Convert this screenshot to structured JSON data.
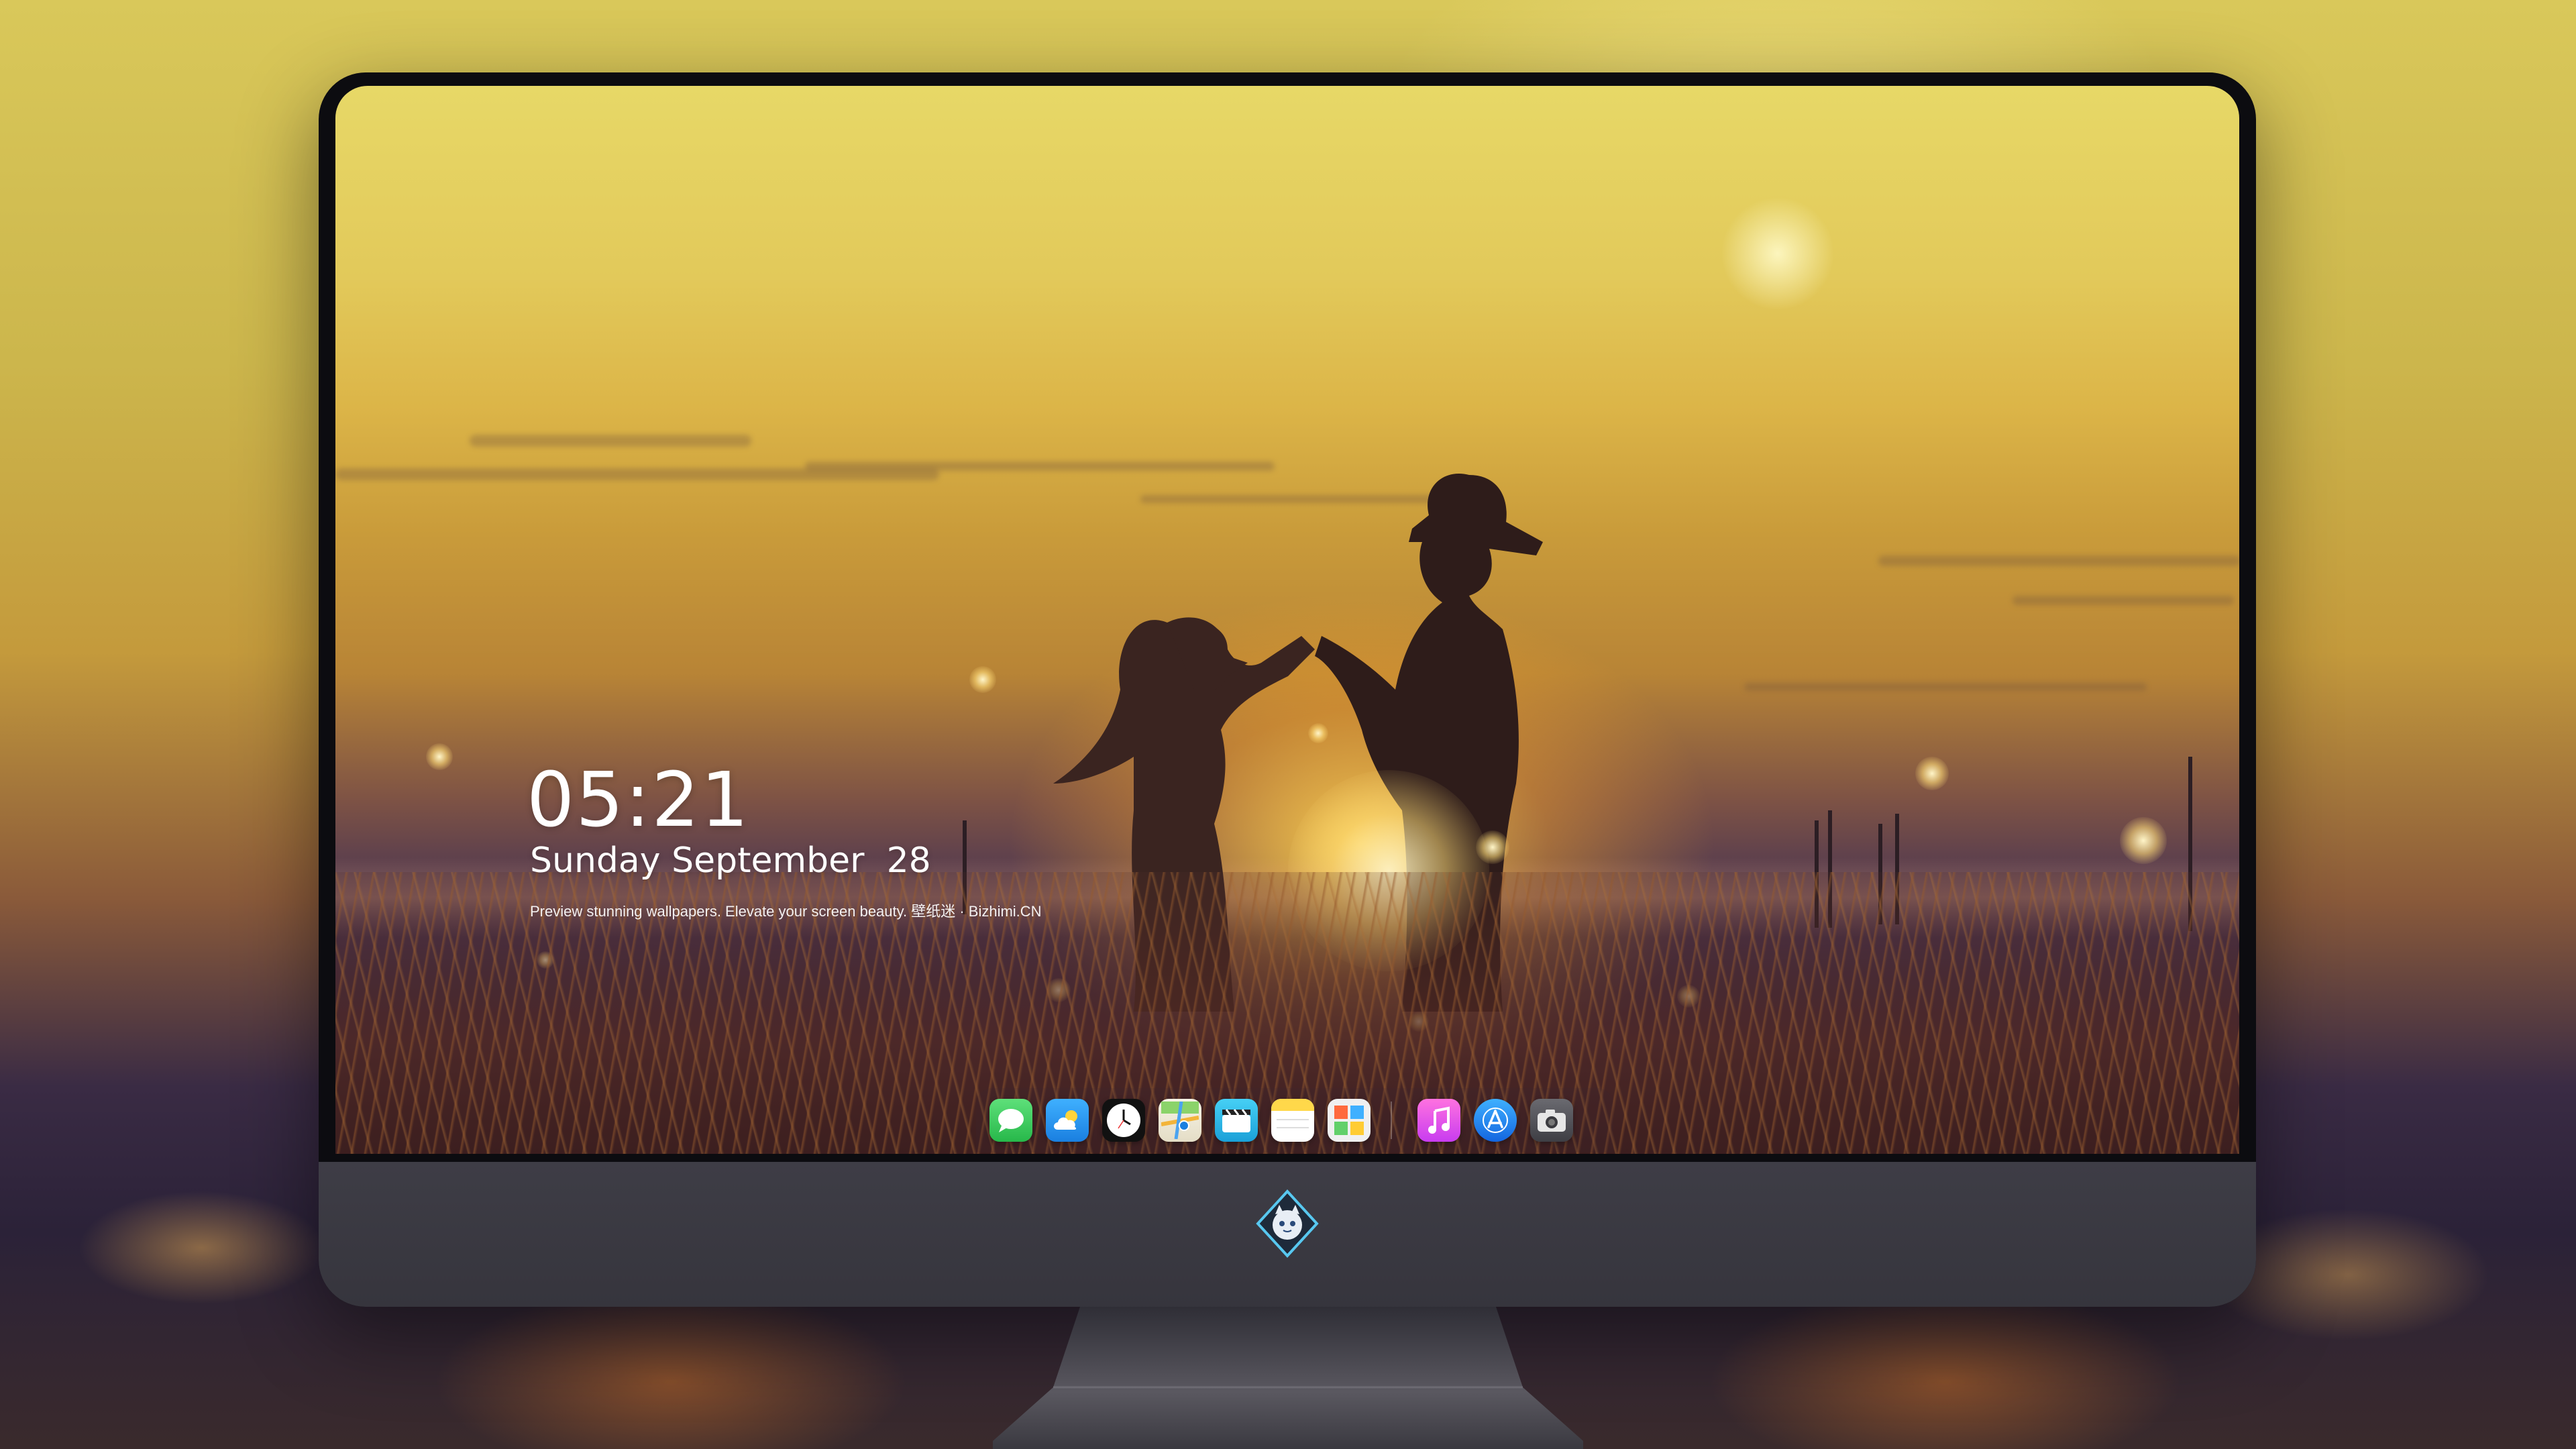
{
  "lockscreen": {
    "time": "05:21",
    "date": "Sunday September  28",
    "caption": "Preview stunning wallpapers. Elevate your screen beauty. 壁纸迷 · Bizhimi.CN"
  },
  "dock": {
    "apps": [
      {
        "name": "messages-icon",
        "color": "#34c759"
      },
      {
        "name": "weather-icon",
        "color": "#2a9df4"
      },
      {
        "name": "clock-icon",
        "color": "#111111"
      },
      {
        "name": "maps-icon",
        "color": "#f4f1e6"
      },
      {
        "name": "clips-icon",
        "color": "#27b6e6"
      },
      {
        "name": "notes-icon",
        "color": "#ffd84a"
      },
      {
        "name": "photo-booth-icon",
        "color": "#e9e9e9"
      },
      {
        "name": "music-icon",
        "color": "#e653d3"
      },
      {
        "name": "app-store-icon",
        "color": "#1a8cff"
      },
      {
        "name": "camera-icon",
        "color": "#5a5a5f"
      }
    ]
  },
  "colors": {
    "monitor_bezel": "#0c0c10",
    "monitor_chin": "#3e3d46",
    "sky_top": "#e7d867",
    "sun_glow": "#ffd250"
  }
}
